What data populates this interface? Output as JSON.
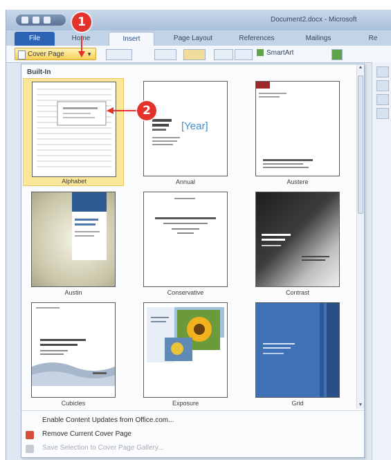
{
  "window": {
    "title": "Document2.docx - Microsoft",
    "tabs": [
      "File",
      "Home",
      "Insert",
      "Page Layout",
      "References",
      "Mailings",
      "Re"
    ]
  },
  "ribbon": {
    "cover_page_label": "Cover Page",
    "smartart_label": "SmartArt"
  },
  "gallery": {
    "section_label": "Built-In",
    "thumbnails": [
      {
        "label": "Alphabet",
        "selected": true
      },
      {
        "label": "Annual",
        "placeholder": "[Year]"
      },
      {
        "label": "Austere"
      },
      {
        "label": "Austin"
      },
      {
        "label": "Conservative"
      },
      {
        "label": "Contrast"
      },
      {
        "label": "Cubicles"
      },
      {
        "label": "Exposure"
      },
      {
        "label": "Grid"
      }
    ]
  },
  "menu": {
    "items": [
      {
        "label": "Enable Content Updates from Office.com...",
        "enabled": true
      },
      {
        "label": "Remove Current Cover Page",
        "enabled": true
      },
      {
        "label": "Save Selection to Cover Page Gallery...",
        "enabled": false
      }
    ]
  },
  "callouts": [
    "1",
    "2"
  ],
  "colors": {
    "callout_red": "#e3312b",
    "selection_yellow": "#fbe79a",
    "file_tab_blue": "#2d63b4",
    "grid_blue": "#3f71b7"
  }
}
